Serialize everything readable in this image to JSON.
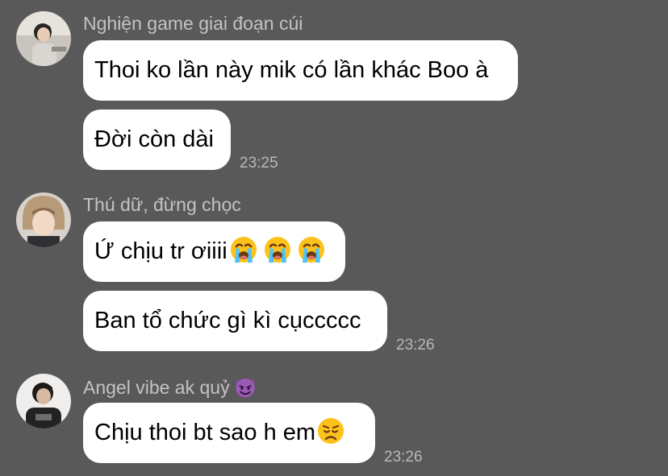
{
  "groups": [
    {
      "sender": "Nghiện game giai đoạn cúi",
      "avatar_icon": "user-avatar-photo",
      "messages": [
        "Thoi ko lần này mik có lần khác Boo à",
        "Đời còn dài"
      ],
      "time": "23:25"
    },
    {
      "sender": "Thú dữ, đừng chọc",
      "avatar_icon": "user-avatar-photo",
      "messages": [
        "Ứ chịu tr ơiiii",
        "Ban tổ chức gì kì cụccccc"
      ],
      "message_emojis": [
        "loudly-crying-face-emoji",
        "loudly-crying-face-emoji",
        "loudly-crying-face-emoji"
      ],
      "time": "23:26"
    },
    {
      "sender": "Angel vibe ak quỷ",
      "sender_emoji": "smiling-face-with-horns-emoji",
      "avatar_icon": "user-avatar-photo",
      "messages": [
        "Chịu thoi bt sao h em"
      ],
      "message_emojis": [
        "disappointed-face-emoji"
      ],
      "time": "23:26"
    }
  ],
  "colors": {
    "background": "#5a595a",
    "bubble": "#ffffff",
    "sender_text": "#c4c2c4",
    "time_text": "#b9b7b9"
  }
}
